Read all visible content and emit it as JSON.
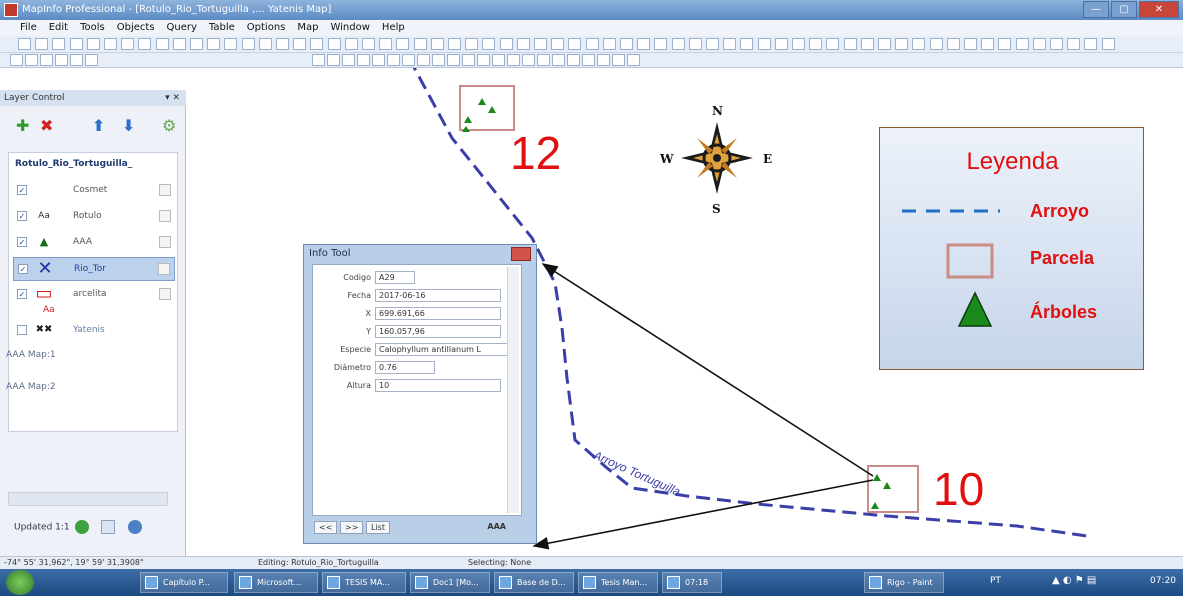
{
  "window": {
    "title": "MapInfo Professional - [Rotulo_Rio_Tortuguilla ,... Yatenis Map]",
    "controls": [
      "—",
      "▢",
      "✕"
    ]
  },
  "menu": [
    "File",
    "Edit",
    "Tools",
    "Objects",
    "Query",
    "Table",
    "Options",
    "Map",
    "Window",
    "Help"
  ],
  "layer_control": {
    "title": "Layer Control",
    "tab_label": "Rotulo_Rio_Tortuguilla_",
    "layers": [
      {
        "name": "Cosmet",
        "checked": "✓",
        "icon": ""
      },
      {
        "name": "Rotulo",
        "checked": "✓",
        "icon": "Aa"
      },
      {
        "name": "AAA",
        "checked": "✓",
        "icon": "▲"
      },
      {
        "name": "Rio_Tor",
        "checked": "✓",
        "icon": "✕"
      },
      {
        "name": "arcelita",
        "checked": "✓",
        "icon": "▭"
      },
      {
        "name": "Yatenis",
        "checked": "",
        "icon": "✖✖"
      }
    ],
    "aa_label": "Aa",
    "map_tabs": [
      "AAA Map:1",
      "AAA Map:2"
    ],
    "updated": "Updated 1:1"
  },
  "info_tool": {
    "title": "Info Tool",
    "fields": [
      {
        "key": "Codigo",
        "value": "A29"
      },
      {
        "key": "Fecha",
        "value": "2017-06-16"
      },
      {
        "key": "X",
        "value": "699.691,66"
      },
      {
        "key": "Y",
        "value": "160.057,96"
      },
      {
        "key": "Especie",
        "value": "Calophyllum antillanum L"
      },
      {
        "key": "Diámetro",
        "value": "0.76"
      },
      {
        "key": "Altura",
        "value": "10"
      }
    ],
    "footer_buttons": [
      "<<",
      ">>",
      "List"
    ],
    "footer_table": "AAA"
  },
  "map": {
    "parcel_12_label": "12",
    "parcel_10_label": "10",
    "river_label": "Arroyo Tortuguilla",
    "compass": {
      "n": "N",
      "s": "S",
      "e": "E",
      "w": "W"
    }
  },
  "legend": {
    "title": "Leyenda",
    "items": [
      "Arroyo",
      "Parcela",
      "Árboles"
    ]
  },
  "statusbar": {
    "coords": "-74° 55' 31,962\", 19° 59' 31,3908\"",
    "editing": "Editing: Rotulo_Rio_Tortuguilla",
    "selecting": "Selecting: None"
  },
  "taskbar": {
    "buttons": [
      "Capítulo P...",
      "Microsoft...",
      "TESIS MA...",
      "Doc1 [Mo...",
      "Base de D...",
      "Tesis Man...",
      "07:18",
      "Rigo - Paint"
    ],
    "lang": "PT",
    "clock": "07:20"
  },
  "colors": {
    "river": "#3a3fa8",
    "parcel": "#c98c86",
    "legend_text": "#e01010",
    "tree": "#1a8a1a"
  }
}
